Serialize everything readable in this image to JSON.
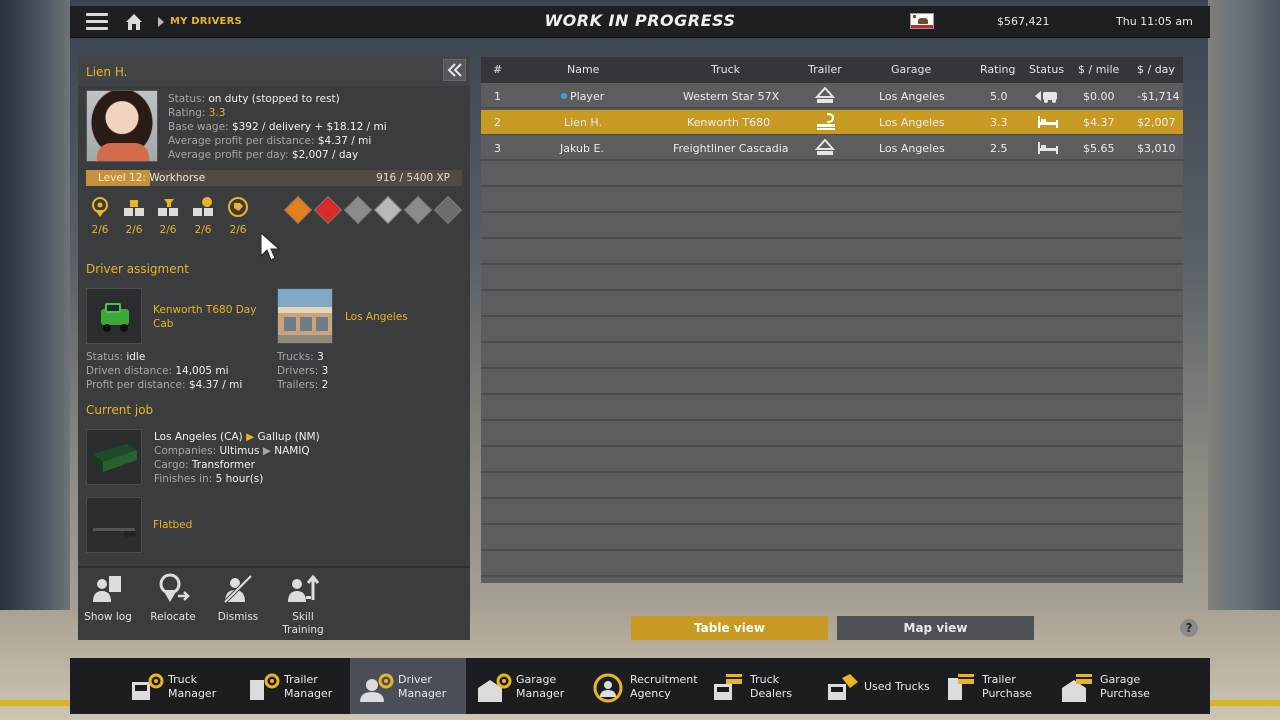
{
  "topbar": {
    "breadcrumb": "MY DRIVERS",
    "title": "WORK IN PROGRESS",
    "money": "$567,421",
    "time": "Thu 11:05 am"
  },
  "driver": {
    "name": "Lien H.",
    "status_label": "Status:",
    "status": "on duty (stopped to rest)",
    "rating_label": "Rating:",
    "rating": "3.3",
    "base_wage_label": "Base wage:",
    "base_wage": "$392 / delivery + $18.12 / mi",
    "avg_profit_distance_label": "Average profit per distance:",
    "avg_profit_distance": "$4.37 / mi",
    "avg_profit_day_label": "Average profit per day:",
    "avg_profit_day": "$2,007 / day",
    "level_text": "Level 12: Workhorse",
    "xp_text": "916 / 5400 XP",
    "xp_fraction": 0.17,
    "skills": [
      "2/6",
      "2/6",
      "2/6",
      "2/6",
      "2/6"
    ]
  },
  "assignment": {
    "heading": "Driver assigment",
    "truck_name": "Kenworth T680 Day Cab",
    "garage_name": "Los Angeles",
    "status_label": "Status:",
    "status": "idle",
    "driven_label": "Driven distance:",
    "driven": "14,005 mi",
    "profit_label": "Profit per distance:",
    "profit": "$4.37 / mi",
    "trucks_label": "Trucks:",
    "trucks": "3",
    "drivers_label": "Drivers:",
    "drivers": "3",
    "trailers_label": "Trailers:",
    "trailers": "2"
  },
  "job": {
    "heading": "Current job",
    "from": "Los Angeles (CA)",
    "to": "Gallup (NM)",
    "companies_label": "Companies:",
    "company_from": "Ultimus",
    "company_to": "NAMIQ",
    "cargo_label": "Cargo:",
    "cargo": "Transformer",
    "finishes_label": "Finishes in:",
    "finishes": "5 hour(s)",
    "trailer": "Flatbed"
  },
  "actions": {
    "show_log": "Show log",
    "relocate": "Relocate",
    "dismiss": "Dismiss",
    "skill_training_1": "Skill",
    "skill_training_2": "Training"
  },
  "table": {
    "headers": {
      "num": "#",
      "name": "Name",
      "truck": "Truck",
      "trailer": "Trailer",
      "garage": "Garage",
      "rating": "Rating",
      "status": "Status",
      "per_mile": "$ / mile",
      "per_day": "$ / day"
    },
    "rows": [
      {
        "num": "1",
        "name": "Player",
        "truck": "Western Star 57X",
        "garage": "Los Angeles",
        "rating": "5.0",
        "per_mile": "$0.00",
        "per_day": "-$1,714"
      },
      {
        "num": "2",
        "name": "Lien H.",
        "truck": "Kenworth T680",
        "garage": "Los Angeles",
        "rating": "3.3",
        "per_mile": "$4.37",
        "per_day": "$2,007"
      },
      {
        "num": "3",
        "name": "Jakub E.",
        "truck": "Freightliner Cascadia",
        "garage": "Los Angeles",
        "rating": "2.5",
        "per_mile": "$5.65",
        "per_day": "$3,010"
      }
    ]
  },
  "views": {
    "table": "Table view",
    "map": "Map view",
    "help": "?"
  },
  "nav": [
    {
      "l1": "Truck",
      "l2": "Manager"
    },
    {
      "l1": "Trailer",
      "l2": "Manager"
    },
    {
      "l1": "Driver",
      "l2": "Manager"
    },
    {
      "l1": "Garage",
      "l2": "Manager"
    },
    {
      "l1": "Recruitment",
      "l2": "Agency"
    },
    {
      "l1": "Truck",
      "l2": "Dealers"
    },
    {
      "l1": "Used Trucks",
      "l2": ""
    },
    {
      "l1": "Trailer",
      "l2": "Purchase"
    },
    {
      "l1": "Garage",
      "l2": "Purchase"
    }
  ],
  "colors": {
    "accent": "#e9b425",
    "selected_row": "#c79a23",
    "player_dot": "#3ea2ea"
  }
}
